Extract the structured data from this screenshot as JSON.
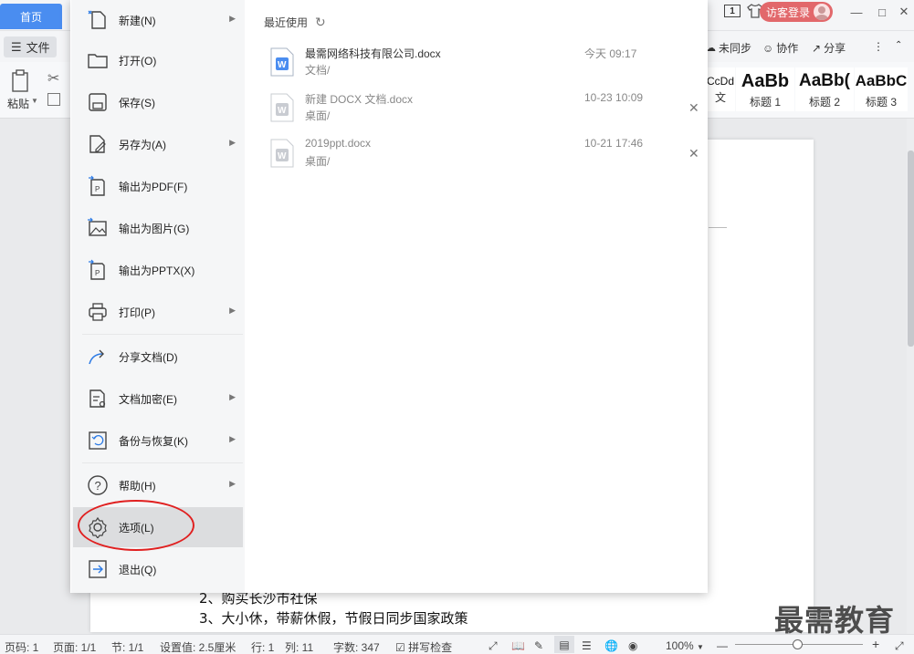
{
  "titlebar": {
    "home_tab": "首页",
    "count": "1",
    "login": "访客登录"
  },
  "toolbar": {
    "file_label": "文件",
    "unsync": "未同步",
    "collab": "协作",
    "share": "分享",
    "more": "⋮",
    "paste_label": "粘贴"
  },
  "styles": [
    {
      "sample": "CcDd",
      "label": "文"
    },
    {
      "sample": "AaBb",
      "label": "标题 1"
    },
    {
      "sample": "AaBb(",
      "label": "标题 2"
    },
    {
      "sample": "AaBbC",
      "label": "标题 3"
    }
  ],
  "file_menu": {
    "items": [
      {
        "label": "新建(N)",
        "icon": "new-file-icon",
        "arrow": true
      },
      {
        "label": "打开(O)",
        "icon": "folder-icon",
        "arrow": false
      },
      {
        "label": "保存(S)",
        "icon": "save-icon",
        "arrow": false
      },
      {
        "label": "另存为(A)",
        "icon": "save-as-icon",
        "arrow": true
      },
      {
        "label": "输出为PDF(F)",
        "icon": "export-pdf-icon",
        "arrow": false
      },
      {
        "label": "输出为图片(G)",
        "icon": "export-image-icon",
        "arrow": false
      },
      {
        "label": "输出为PPTX(X)",
        "icon": "export-pptx-icon",
        "arrow": false
      },
      {
        "label": "打印(P)",
        "icon": "print-icon",
        "arrow": true
      },
      {
        "label": "分享文档(D)",
        "icon": "share-icon",
        "arrow": false
      },
      {
        "label": "文档加密(E)",
        "icon": "encrypt-icon",
        "arrow": true
      },
      {
        "label": "备份与恢复(K)",
        "icon": "backup-icon",
        "arrow": true
      },
      {
        "label": "帮助(H)",
        "icon": "help-icon",
        "arrow": true
      },
      {
        "label": "选项(L)",
        "icon": "gear-icon",
        "arrow": false
      },
      {
        "label": "退出(Q)",
        "icon": "exit-icon",
        "arrow": false
      }
    ]
  },
  "recent": {
    "title": "最近使用",
    "files": [
      {
        "name": "最需网络科技有限公司.docx",
        "path": "文档/",
        "time": "今天 09:17"
      },
      {
        "name": "新建 DOCX 文档.docx",
        "path": "桌面/",
        "time": "10-23 10:09"
      },
      {
        "name": "2019ppt.docx",
        "path": "桌面/",
        "time": "10-21 17:46"
      }
    ]
  },
  "document": {
    "lines": [
      "2、购买长沙市社保",
      "3、大小休，带薪休假，节假日同步国家政策"
    ]
  },
  "watermark": "最需教育",
  "statusbar": {
    "page_num": "页码: 1",
    "pages": "页面: 1/1",
    "section": "节: 1/1",
    "setting": "设置值: 2.5厘米",
    "row": "行: 1",
    "col": "列: 11",
    "words": "字数: 347",
    "spell": "拼写检查",
    "zoom": "100%"
  }
}
